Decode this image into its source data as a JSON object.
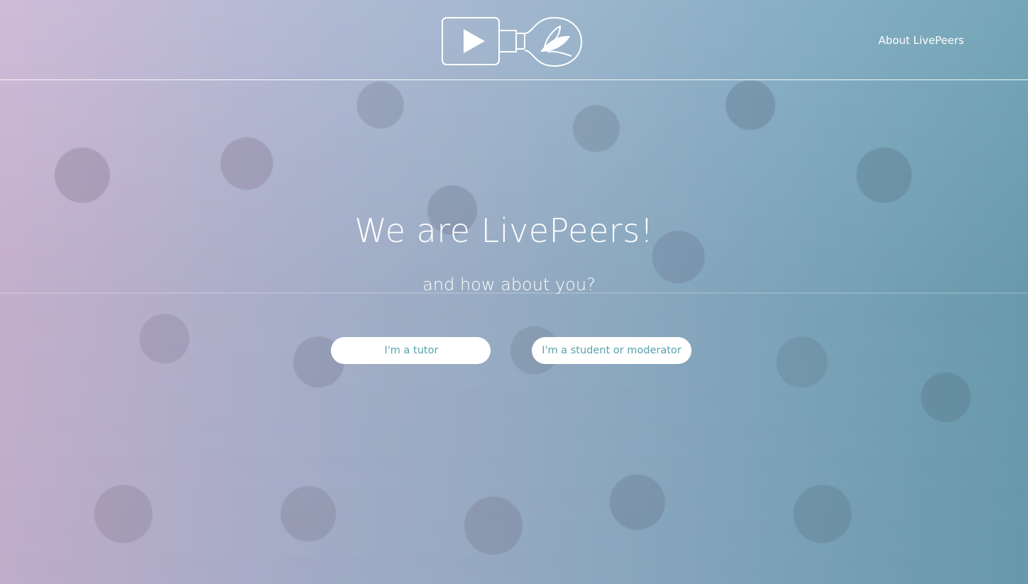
{
  "header": {
    "nav_about_label": "About LivePeers"
  },
  "hero": {
    "title": "We are LivePeers!",
    "subtitle": "and how about you?"
  },
  "actions": {
    "tutor_label": "I'm a tutor",
    "student_label": "I'm a student or moderator"
  },
  "colors": {
    "gradient_left": "#cdb8d6",
    "gradient_right": "#6ea2b5",
    "button_text": "#56a3ad",
    "button_bg": "#ffffff"
  },
  "icons": {
    "logo": "video-camera-play-plus-lightbulb-leaf-logo"
  }
}
